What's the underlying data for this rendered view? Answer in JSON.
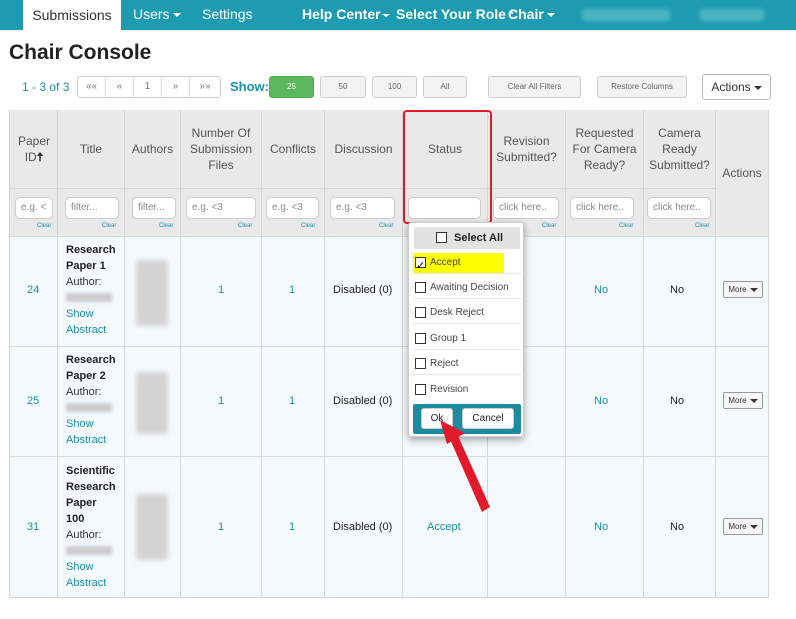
{
  "nav": {
    "submissions": "Submissions",
    "users": "Users",
    "settings": "Settings",
    "help_center": "Help Center",
    "select_role": "Select Your Role :",
    "role": "Chair"
  },
  "page_title": "Chair Console",
  "toolbar": {
    "count": "1 - 3 of 3",
    "pager": [
      "««",
      "«",
      "1",
      "»",
      "»»"
    ],
    "show_label": "Show:",
    "page_sizes": [
      "25",
      "50",
      "100",
      "All"
    ],
    "clear_filters": "Clear All Filters",
    "restore_columns": "Restore Columns",
    "actions": "Actions"
  },
  "columns": {
    "paper_id": "Paper ID",
    "title": "Title",
    "authors": "Authors",
    "num_files": "Number Of Submission Files",
    "conflicts": "Conflicts",
    "discussion": "Discussion",
    "status": "Status",
    "revision": "Revision Submitted?",
    "requested_cr": "Requested For Camera Ready?",
    "cr_submitted": "Camera Ready Submitted?",
    "actions": "Actions"
  },
  "filters": {
    "paper_id": "e.g. <",
    "title": "filter...",
    "authors": "filter...",
    "num_files": "e.g. <3",
    "conflicts": "e.g. <3",
    "discussion": "e.g. <3",
    "status": "",
    "revision": "click here..",
    "requested_cr": "click here..",
    "cr_submitted": "click here..",
    "clear": "Clear"
  },
  "rows": [
    {
      "id": "24",
      "title": [
        "Research",
        "Paper 1"
      ],
      "author_label": "Author:",
      "show": "Show",
      "abstract": "Abstract",
      "files": "1",
      "conflicts": "1",
      "discussion": "Disabled (0)",
      "status": "",
      "requested": "No",
      "cr": "No",
      "more": "More"
    },
    {
      "id": "25",
      "title": [
        "Research",
        "Paper 2"
      ],
      "author_label": "Author:",
      "show": "Show",
      "abstract": "Abstract",
      "files": "1",
      "conflicts": "1",
      "discussion": "Disabled (0)",
      "status": "",
      "requested": "No",
      "cr": "No",
      "more": "More"
    },
    {
      "id": "31",
      "title": [
        "Scientific",
        "Research",
        "Paper",
        "100"
      ],
      "author_label": "Author:",
      "show": "Show",
      "abstract": "Abstract",
      "files": "1",
      "conflicts": "1",
      "discussion": "Disabled (0)",
      "status": "Accept",
      "requested": "No",
      "cr": "No",
      "more": "More"
    }
  ],
  "status_dropdown": {
    "select_all": "Select All",
    "options": [
      {
        "label": "Accept",
        "checked": true
      },
      {
        "label": "Awaiting Decision",
        "checked": false
      },
      {
        "label": "Desk Reject",
        "checked": false
      },
      {
        "label": "Group 1",
        "checked": false
      },
      {
        "label": "Reject",
        "checked": false
      },
      {
        "label": "Revision",
        "checked": false
      }
    ],
    "ok": "Ok",
    "cancel": "Cancel"
  },
  "colors": {
    "nav_bg": "#1d9bb0",
    "link": "#1a8fa6",
    "highlight": "#ffff00",
    "annotation": "#e2192b",
    "show_active": "#5cb85c"
  }
}
